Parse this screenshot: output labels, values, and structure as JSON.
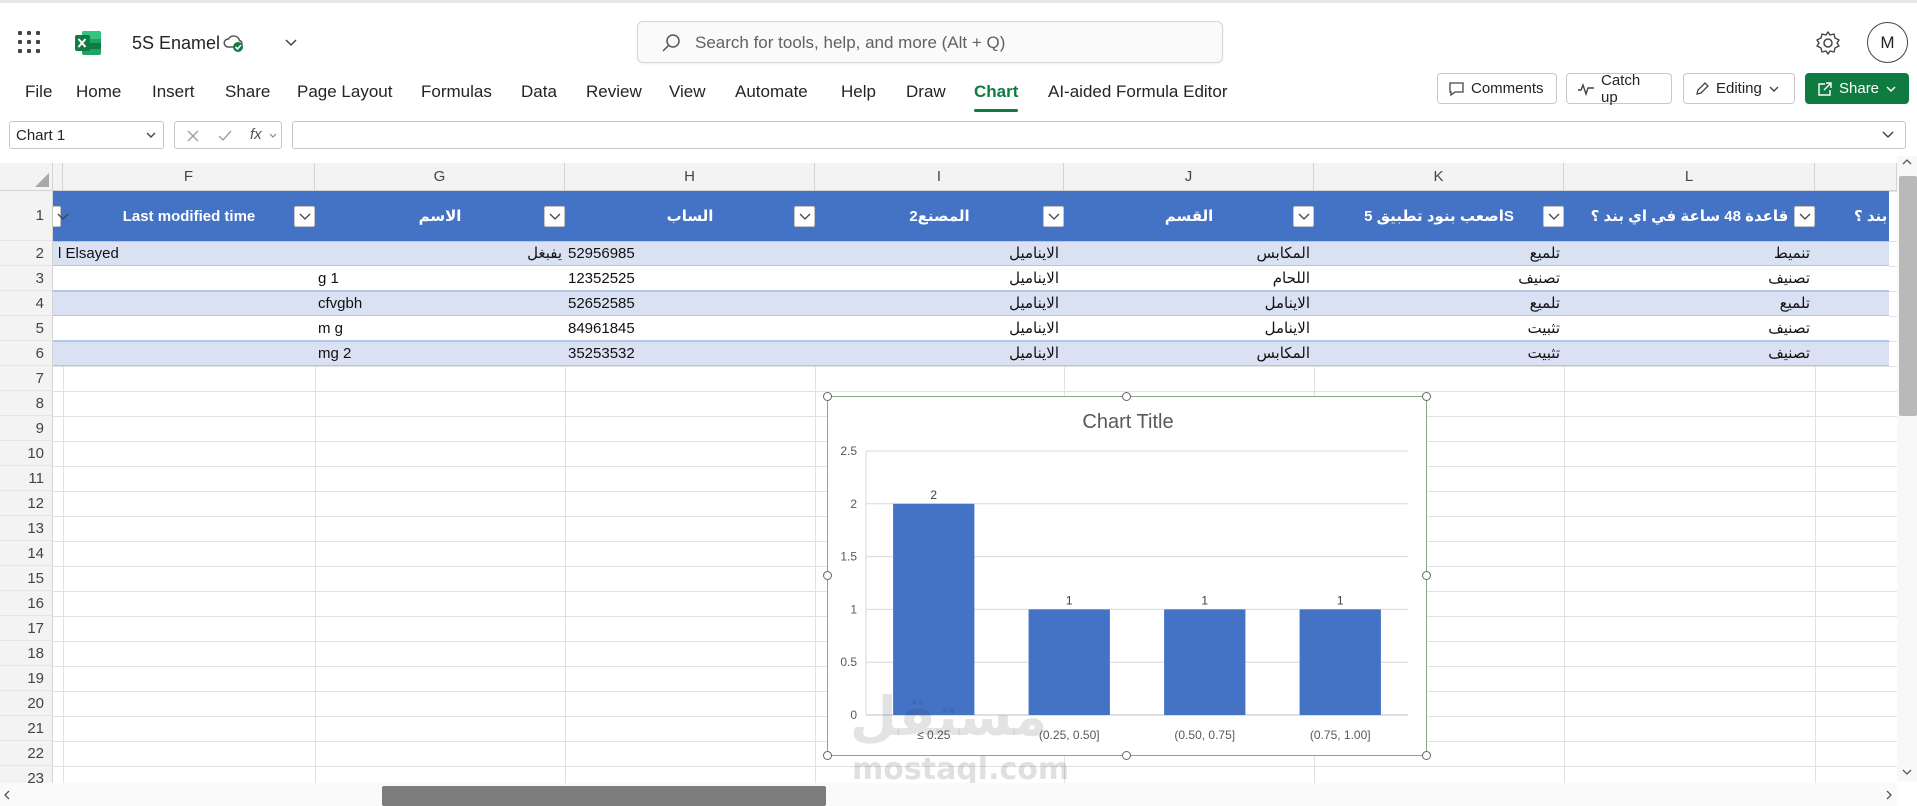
{
  "app": {
    "doc_title": "5S Enamel",
    "user_initial": "M"
  },
  "search": {
    "placeholder": "Search for tools, help, and more (Alt + Q)"
  },
  "menu": [
    {
      "label": "File",
      "active": false
    },
    {
      "label": "Home",
      "active": false
    },
    {
      "label": "Insert",
      "active": false
    },
    {
      "label": "Share",
      "active": false
    },
    {
      "label": "Page Layout",
      "active": false
    },
    {
      "label": "Formulas",
      "active": false
    },
    {
      "label": "Data",
      "active": false
    },
    {
      "label": "Review",
      "active": false
    },
    {
      "label": "View",
      "active": false
    },
    {
      "label": "Automate",
      "active": false
    },
    {
      "label": "Help",
      "active": false
    },
    {
      "label": "Draw",
      "active": false
    },
    {
      "label": "Chart",
      "active": true
    },
    {
      "label": "AI-aided Formula Editor",
      "active": false
    }
  ],
  "actions": {
    "comments": "Comments",
    "catch_up": "Catch up",
    "editing": "Editing",
    "share": "Share"
  },
  "formula_bar": {
    "name_box": "Chart 1",
    "fx": "fx",
    "value": ""
  },
  "columns": [
    "F",
    "G",
    "H",
    "I",
    "J",
    "K",
    "L"
  ],
  "rows": [
    "1",
    "2",
    "3",
    "4",
    "5",
    "6",
    "7",
    "8",
    "9",
    "10",
    "11",
    "12",
    "13",
    "14",
    "15",
    "16",
    "17",
    "18",
    "19",
    "20",
    "21",
    "22",
    "23"
  ],
  "table": {
    "header_partial_left": "",
    "header_partial_right": "بند ؟",
    "headers": [
      "Last modified time",
      "الاسم",
      "الساب",
      "المصنع2",
      "القسم",
      "اصعب بنود تطبيق 5S",
      "قاعدة 48 ساعة في اي بند ؟"
    ],
    "data_rows": [
      {
        "e": "l Elsayed",
        "f": "",
        "g": "يفبغل",
        "h": "52956985",
        "i": "الايناميل",
        "j": "المكابس",
        "k": "تلميع",
        "l": "تنميط"
      },
      {
        "e": "",
        "f": "",
        "g": "g 1",
        "h": "12352525",
        "i": "الايناميل",
        "j": "اللحام",
        "k": "تصنيف",
        "l": "تصنيف"
      },
      {
        "e": "",
        "f": "",
        "g": "cfvgbh",
        "h": "52652585",
        "i": "الايناميل",
        "j": "الاينامل",
        "k": "تلميع",
        "l": "تلميع"
      },
      {
        "e": "",
        "f": "",
        "g": "m g",
        "h": "84961845",
        "i": "الايناميل",
        "j": "الاينامل",
        "k": "تثبيت",
        "l": "تصنيف"
      },
      {
        "e": "",
        "f": "",
        "g": "mg 2",
        "h": "35253532",
        "i": "الايناميل",
        "j": "المكابس",
        "k": "تثبيت",
        "l": "تصنيف"
      }
    ]
  },
  "chart_data": {
    "type": "bar",
    "title": "Chart Title",
    "categories": [
      "≤ 0.25",
      "(0.25, 0.50]",
      "(0.50, 0.75]",
      "(0.75, 1.00]"
    ],
    "values": [
      2,
      1,
      1,
      1
    ],
    "data_labels": [
      "2",
      "1",
      "1",
      "1"
    ],
    "ylim": [
      0,
      2.5
    ],
    "yticks": [
      "0",
      "0.5",
      "1",
      "1.5",
      "2",
      "2.5"
    ],
    "ytick_values": [
      0,
      0.5,
      1,
      1.5,
      2,
      2.5
    ],
    "grid": true,
    "bar_color": "#4472c4"
  },
  "watermark": {
    "ar": "مستقل",
    "en": "mostaql.com"
  },
  "colors": {
    "accent": "#107c41",
    "table_header": "#4472c4",
    "band": "#d9e1f2"
  }
}
